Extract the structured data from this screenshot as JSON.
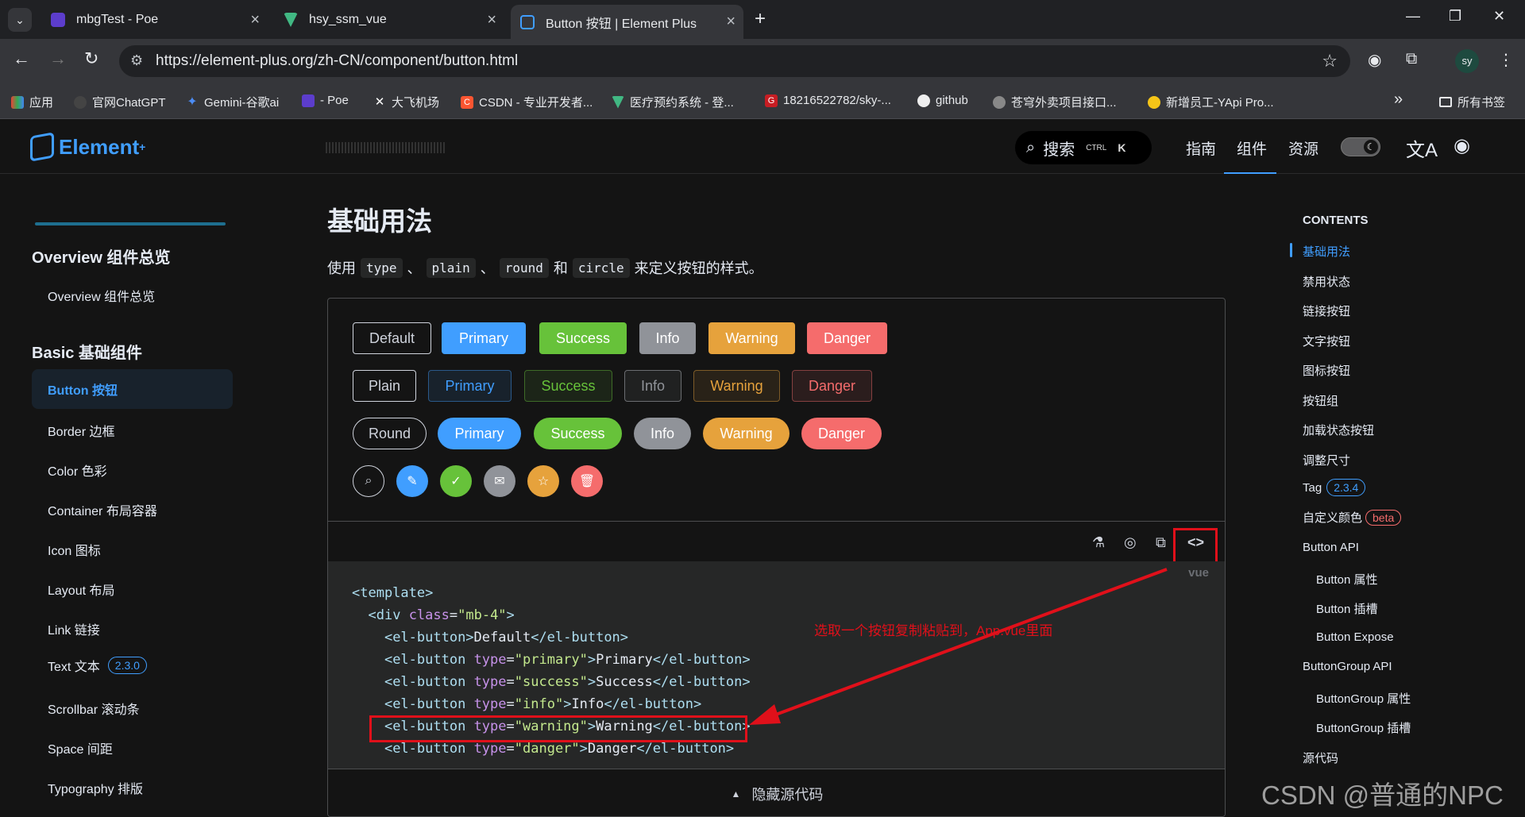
{
  "browser": {
    "tabs": [
      {
        "title": "mbgTest - Poe"
      },
      {
        "title": "hsy_ssm_vue"
      },
      {
        "title": "Button 按钮 | Element Plus"
      }
    ],
    "url": "https://element-plus.org/zh-CN/component/button.html",
    "avatar": "sy",
    "bookmarks": [
      "应用",
      "官网ChatGPT",
      "Gemini-谷歌ai",
      "- Poe",
      "大飞机场",
      "CSDN - 专业开发者...",
      "医疗预约系统 - 登...",
      "18216522782/sky-...",
      "github",
      "苍穹外卖项目接口...",
      "新增员工-YApi Pro..."
    ],
    "bookmarks_folder": "所有书签",
    "more": "»"
  },
  "topnav": {
    "logo": "Element",
    "logo_plus": "+",
    "search_label": "搜索",
    "kbd_ctrl": "CTRL",
    "kbd_k": "K",
    "links": [
      "指南",
      "组件",
      "资源"
    ]
  },
  "sidebar": {
    "groups": [
      {
        "title": "Overview 组件总览",
        "items": [
          "Overview 组件总览"
        ]
      },
      {
        "title": "Basic 基础组件",
        "items": [
          "Button 按钮",
          "Border 边框",
          "Color 色彩",
          "Container 布局容器",
          "Icon 图标",
          "Layout 布局",
          "Link 链接",
          "Text 文本",
          "Scrollbar 滚动条",
          "Space 间距",
          "Typography 排版"
        ]
      }
    ],
    "text_version": "2.3.0"
  },
  "main": {
    "heading": "基础用法",
    "desc_prefix": "使用",
    "desc_codes": [
      "type",
      "plain",
      "round",
      "circle"
    ],
    "desc_sep1": "、",
    "desc_sep2": "、",
    "desc_and": "和",
    "desc_suffix": "来定义按钮的样式。",
    "rows": {
      "default": [
        "Default",
        "Primary",
        "Success",
        "Info",
        "Warning",
        "Danger"
      ],
      "plain": [
        "Plain",
        "Primary",
        "Success",
        "Info",
        "Warning",
        "Danger"
      ],
      "round": [
        "Round",
        "Primary",
        "Success",
        "Info",
        "Warning",
        "Danger"
      ]
    },
    "circle_icons": [
      "search-icon",
      "edit-icon",
      "check-icon",
      "message-icon",
      "star-icon",
      "delete-icon"
    ],
    "code_lang": "vue",
    "code_lines": [
      "<template>",
      "  <div class=\"mb-4\">",
      "    <el-button>Default</el-button>",
      "    <el-button type=\"primary\">Primary</el-button>",
      "    <el-button type=\"success\">Success</el-button>",
      "    <el-button type=\"info\">Info</el-button>",
      "    <el-button type=\"warning\">Warning</el-button>",
      "    <el-button type=\"danger\">Danger</el-button>"
    ],
    "annotation": "选取一个按钮复制粘贴到，App.vue里面",
    "hide_code": "隐藏源代码"
  },
  "toc": {
    "title": "CONTENTS",
    "items": [
      "基础用法",
      "禁用状态",
      "链接按钮",
      "文字按钮",
      "图标按钮",
      "按钮组",
      "加载状态按钮",
      "调整尺寸",
      "Tag",
      "自定义颜色",
      "Button API",
      "Button 属性",
      "Button 插槽",
      "Button Expose",
      "ButtonGroup API",
      "ButtonGroup 属性",
      "ButtonGroup 插槽",
      "源代码"
    ],
    "tag_version": "2.3.4",
    "beta": "beta"
  },
  "watermark": "CSDN @普通的NPC",
  "colors": {
    "primary": "#409eff",
    "success": "#67c23a",
    "info": "#909399",
    "warning": "#e6a23c",
    "danger": "#f56c6c",
    "annotation": "#e0101a"
  }
}
